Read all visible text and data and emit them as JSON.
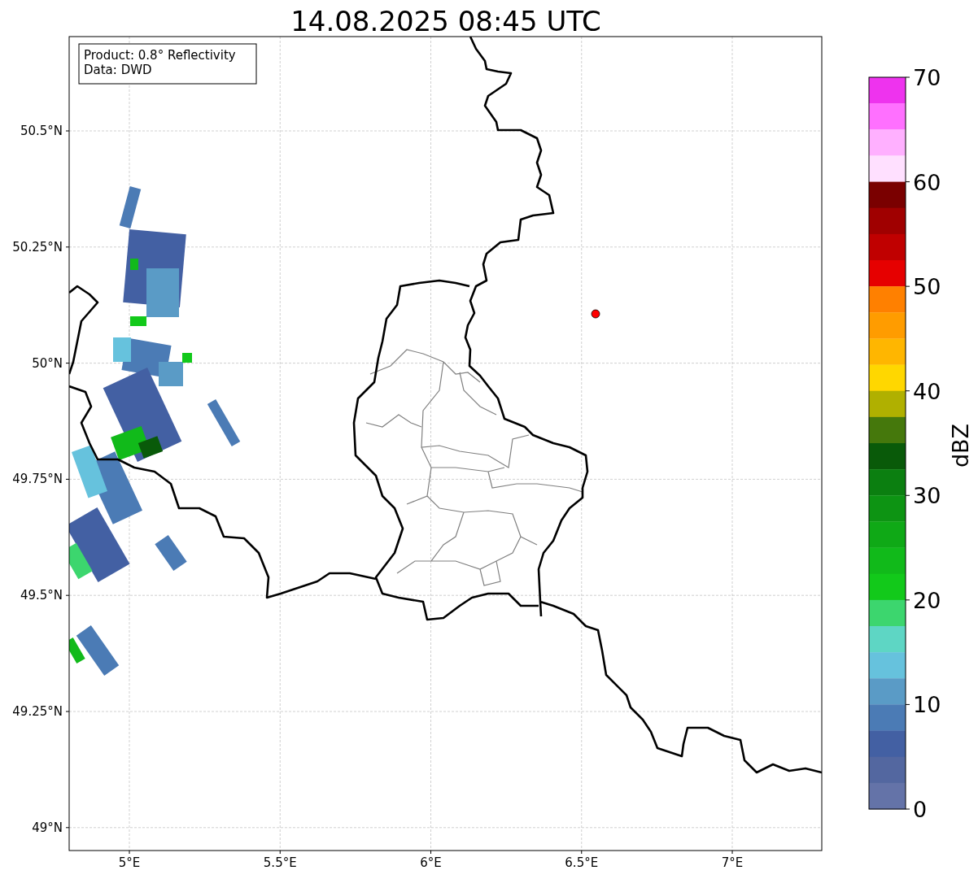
{
  "title": "14.08.2025 08:45 UTC",
  "info_box": {
    "lines": [
      "Product: 0.8° Reflectivity",
      "Data: DWD"
    ]
  },
  "map": {
    "lon_ticks": [
      "5°E",
      "5.5°E",
      "6°E",
      "6.5°E",
      "7°E"
    ],
    "lat_ticks": [
      "50.5°N",
      "50.25°N",
      "50°N",
      "49.75°N",
      "49.5°N",
      "49.25°N",
      "49°N"
    ]
  },
  "colorbar": {
    "label": "dBZ",
    "ticks": [
      "70",
      "60",
      "50",
      "40",
      "30",
      "20",
      "10",
      "0"
    ],
    "segments": [
      {
        "color": "#ee33ee"
      },
      {
        "color": "#ff70ff"
      },
      {
        "color": "#ffb0ff"
      },
      {
        "color": "#ffe0ff"
      },
      {
        "color": "#7a0000"
      },
      {
        "color": "#a00000"
      },
      {
        "color": "#c00000"
      },
      {
        "color": "#e60000"
      },
      {
        "color": "#ff8000"
      },
      {
        "color": "#ff9c00"
      },
      {
        "color": "#ffb600"
      },
      {
        "color": "#ffd700"
      },
      {
        "color": "#b0b000"
      },
      {
        "color": "#45780c"
      },
      {
        "color": "#095a09"
      },
      {
        "color": "#0b7f10"
      },
      {
        "color": "#0d9413"
      },
      {
        "color": "#0fa916"
      },
      {
        "color": "#11ba1a"
      },
      {
        "color": "#12c91a"
      },
      {
        "color": "#3cd66e"
      },
      {
        "color": "#5ed6c4"
      },
      {
        "color": "#66c2dd"
      },
      {
        "color": "#5a9bc6"
      },
      {
        "color": "#4b7bb5"
      },
      {
        "color": "#4360a3"
      },
      {
        "color": "#5367a0"
      },
      {
        "color": "#6473a8"
      }
    ]
  }
}
